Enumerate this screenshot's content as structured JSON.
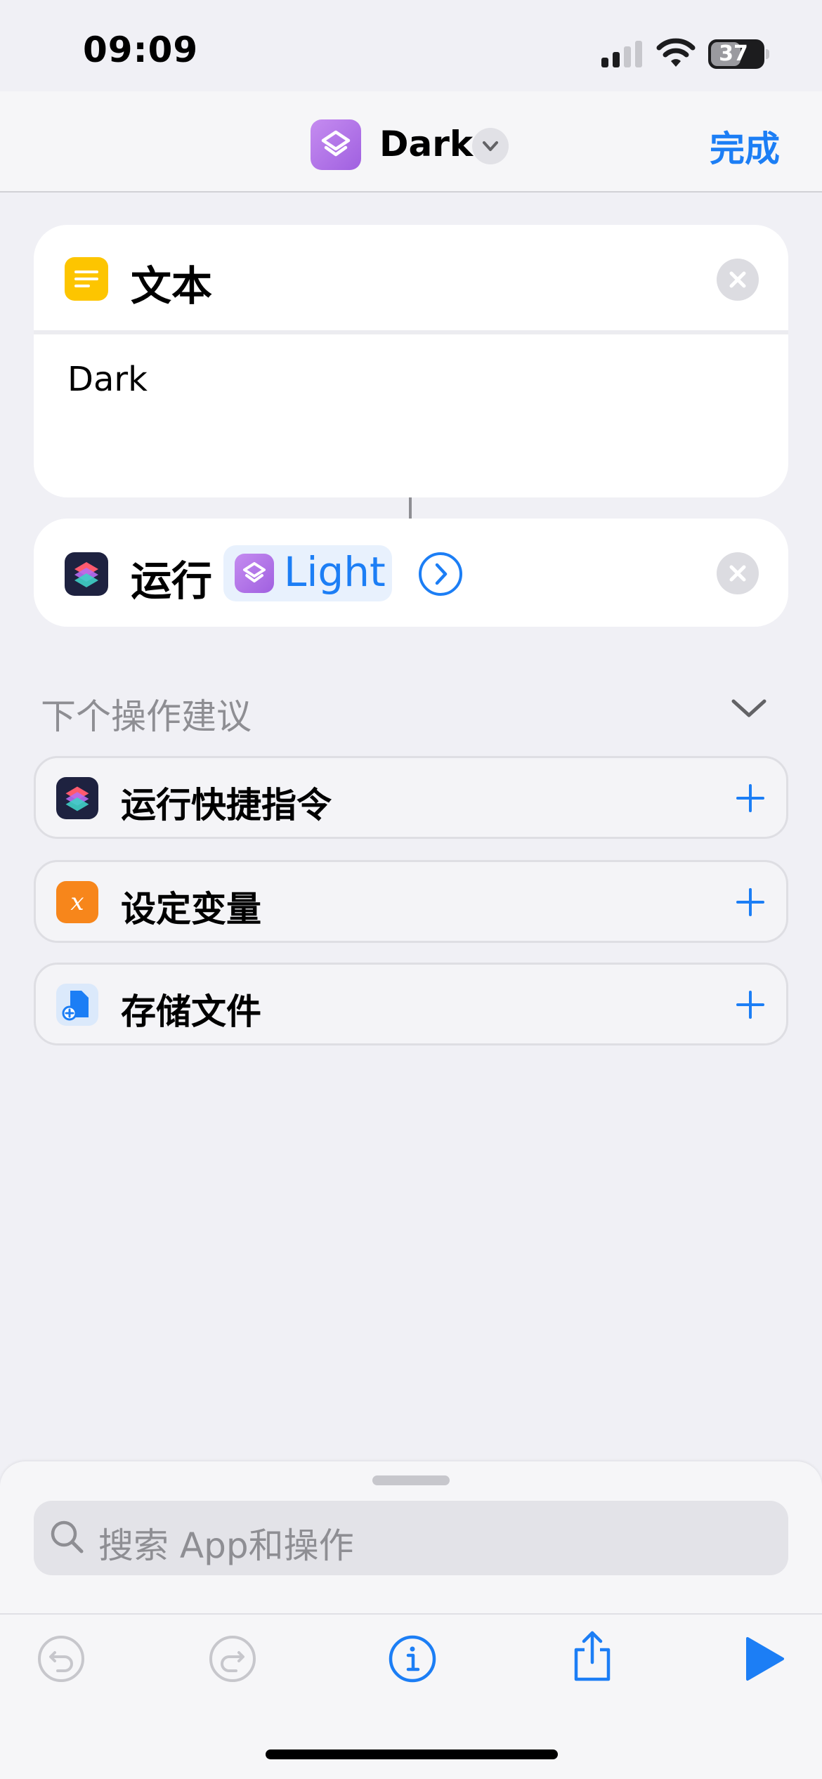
{
  "status_bar": {
    "time": "09:09",
    "battery": "37"
  },
  "nav": {
    "title": "Dark",
    "done_label": "完成"
  },
  "text_action": {
    "title": "文本",
    "value": "Dark"
  },
  "run_action": {
    "label": "运行",
    "shortcut": "Light"
  },
  "suggestions": {
    "header": "下个操作建议",
    "items": [
      {
        "label": "运行快捷指令",
        "icon": "shortcuts-icon"
      },
      {
        "label": "设定变量",
        "icon": "variable-icon"
      },
      {
        "label": "存储文件",
        "icon": "save-file-icon"
      }
    ]
  },
  "search": {
    "placeholder": "搜索 App和操作"
  },
  "colors": {
    "accent": "#1c7ef5",
    "text_icon": "#fdc500",
    "variable_icon": "#f7861b",
    "shortcut_icon": "#a060e0"
  }
}
